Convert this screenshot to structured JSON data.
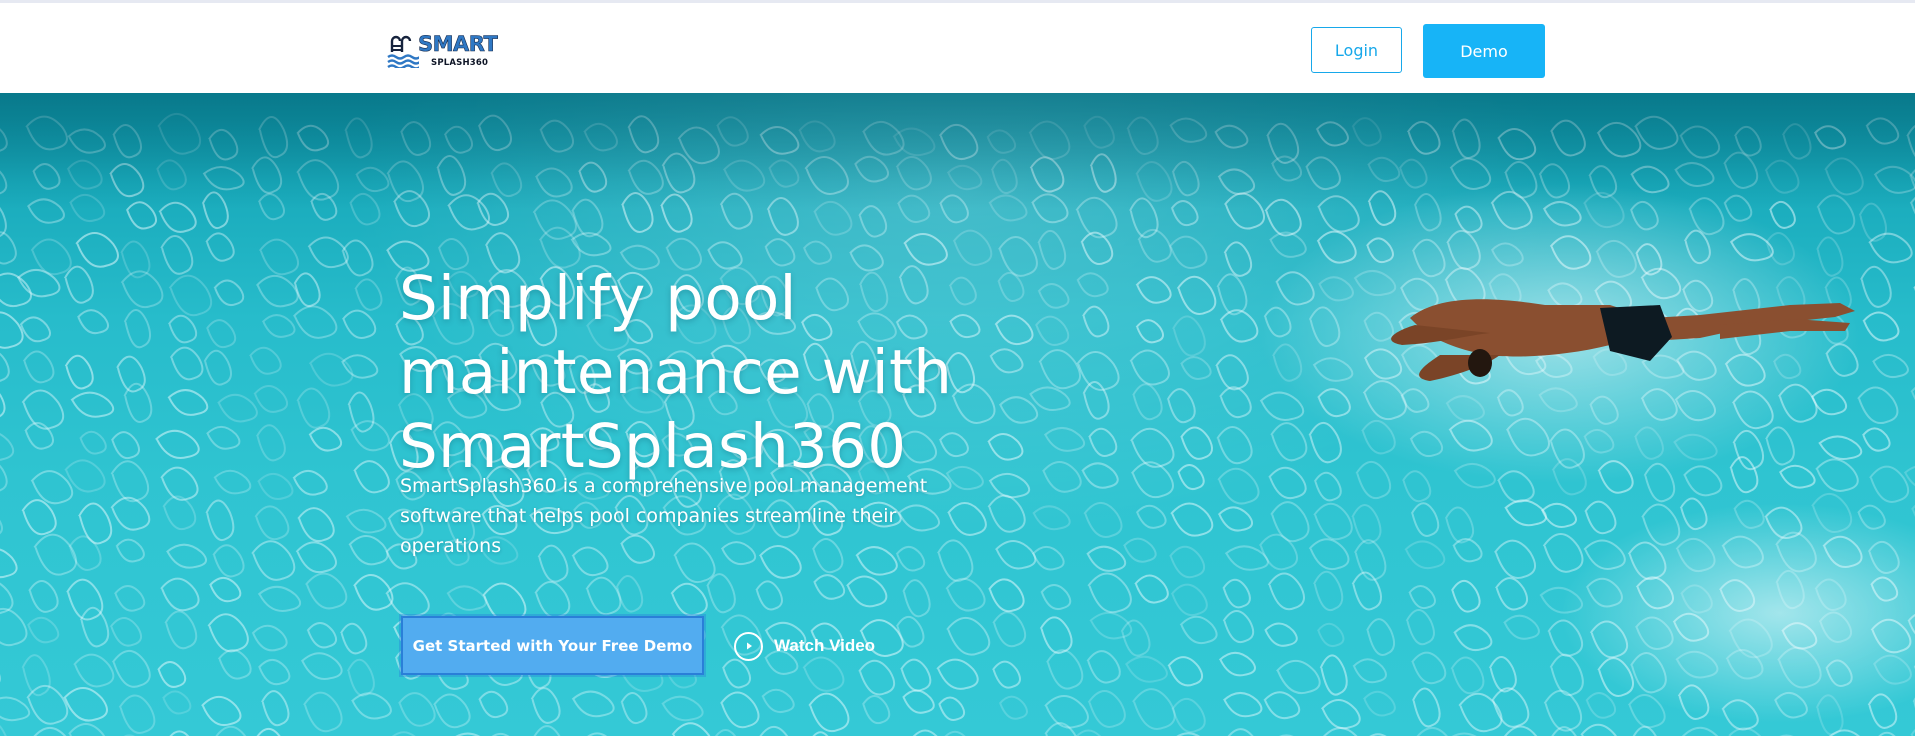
{
  "header": {
    "logo_word1": "SMART",
    "logo_word2": "SPLASH360",
    "login_label": "Login",
    "demo_label": "Demo"
  },
  "hero": {
    "title_lines": [
      "Simplify pool",
      "maintenance with",
      "SmartSplash360"
    ],
    "subtitle_lines": [
      "SmartSplash360 is a comprehensive pool management",
      "software that helps pool companies streamline their",
      "operations"
    ],
    "cta_label": "Get Started with Your Free Demo",
    "watch_video_label": "Watch Video"
  },
  "icons": {
    "logo": "pool-ladder-wave-icon",
    "play": "play-circle-icon"
  },
  "colors": {
    "accent": "#17b4f7",
    "cta": "#52acf0",
    "water": "#2fc4d1"
  }
}
